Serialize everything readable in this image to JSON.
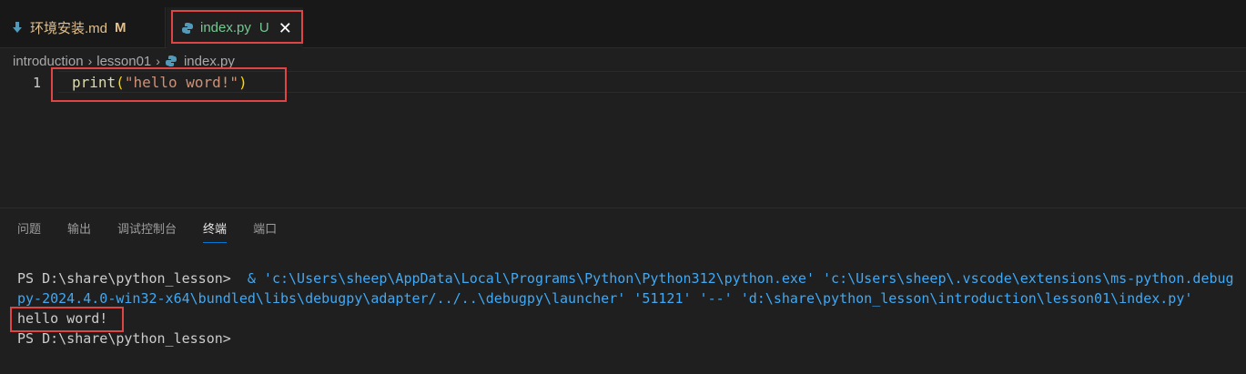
{
  "tabs": [
    {
      "label": "环境安装.md",
      "status": "M",
      "icon": "markdown-download-icon"
    },
    {
      "label": "index.py",
      "status": "U",
      "close": "✕",
      "icon": "python-icon"
    }
  ],
  "breadcrumb": [
    "introduction",
    "lesson01",
    "index.py"
  ],
  "editor": {
    "line_number": "1",
    "code_fn": "print",
    "code_open": "(",
    "code_str": "\"hello word!\"",
    "code_close": ")"
  },
  "panel_tabs": [
    "问题",
    "输出",
    "调试控制台",
    "终端",
    "端口"
  ],
  "active_panel_tab": "终端",
  "terminal": {
    "prompt1": "PS D:\\share\\python_lesson> ",
    "cmd_line1": " & 'c:\\Users\\sheep\\AppData\\Local\\Programs\\Python\\Python312\\python.exe' 'c:\\Users\\sheep\\.vscode\\extensions\\ms-python.debug",
    "cmd_line2": "py-2024.4.0-win32-x64\\bundled\\libs\\debugpy\\adapter/../..\\debugpy\\launcher' '51121' '--' 'd:\\share\\python_lesson\\introduction\\lesson01\\index.py'",
    "output": "hello word!",
    "prompt2": "PS D:\\share\\python_lesson>"
  },
  "colors": {
    "highlight": "#e04545",
    "modified": "#e2c08d",
    "untracked": "#73c991",
    "accent": "#0078d4"
  }
}
